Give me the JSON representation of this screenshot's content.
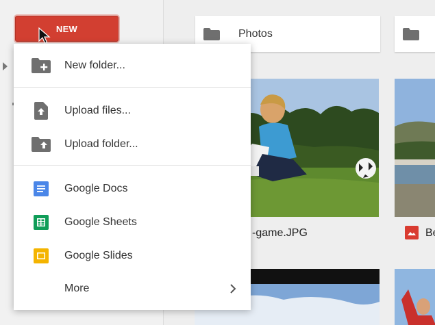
{
  "sidebar": {
    "new_button_label": "NEW"
  },
  "folders": [
    {
      "name": "Photos"
    },
    {
      "name": ""
    }
  ],
  "files": [
    {
      "name": "-game.JPG"
    },
    {
      "name": "Be"
    }
  ],
  "new_menu": {
    "items": [
      {
        "label": "New folder...",
        "icon": "new-folder-icon"
      },
      {
        "label": "Upload files...",
        "icon": "upload-file-icon"
      },
      {
        "label": "Upload folder...",
        "icon": "upload-folder-icon"
      },
      {
        "label": "Google Docs",
        "icon": "google-docs-icon"
      },
      {
        "label": "Google Sheets",
        "icon": "google-sheets-icon"
      },
      {
        "label": "Google Slides",
        "icon": "google-slides-icon"
      },
      {
        "label": "More",
        "icon": "chevron-right-icon"
      }
    ]
  },
  "colors": {
    "new_button": "#d23f31",
    "docs_blue": "#4a86e8",
    "sheets_green": "#0f9d58",
    "slides_yellow": "#f4b400",
    "image_file_red": "#d93b30"
  }
}
